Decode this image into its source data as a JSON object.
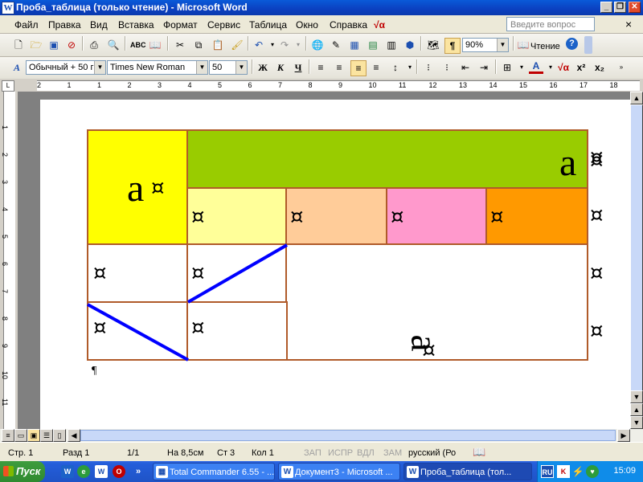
{
  "window": {
    "title": "Проба_таблица (только чтение) - Microsoft Word",
    "app_icon": "W"
  },
  "menu": {
    "items": [
      "Файл",
      "Правка",
      "Вид",
      "Вставка",
      "Формат",
      "Сервис",
      "Таблица",
      "Окно",
      "Справка"
    ],
    "ask_placeholder": "Введите вопрос"
  },
  "toolbar_standard": {
    "zoom": "90%",
    "reading_label": "Чтение"
  },
  "toolbar_format": {
    "style": "Обычный + 50 г",
    "font": "Times New Roman",
    "size": "50",
    "bold": "Ж",
    "italic": "К",
    "underline": "Ч"
  },
  "ruler": {
    "h_marks": [
      "2",
      "1",
      "1",
      "2",
      "3",
      "4",
      "5",
      "6",
      "7",
      "8",
      "9",
      "10",
      "11",
      "12",
      "13",
      "14",
      "15",
      "16",
      "17",
      "18"
    ],
    "v_marks": [
      "1",
      "2",
      "3",
      "4",
      "5",
      "6",
      "7",
      "8",
      "9",
      "10",
      "11"
    ]
  },
  "document": {
    "cell_mark": "¤",
    "big_letter": "a",
    "paragraph_mark": "¶",
    "colors": {
      "yellow": "#ffff00",
      "green": "#99cc00",
      "light_yellow": "#ffff99",
      "peach": "#ffcc99",
      "pink": "#ff99cc",
      "orange": "#ff9900",
      "border": "#b05b2a",
      "diagonal": "#0000ff"
    }
  },
  "status": {
    "page": "Стр. 1",
    "section": "Разд 1",
    "pages": "1/1",
    "at": "На 8,5см",
    "line": "Ст 3",
    "col": "Кол 1",
    "rec": "ЗАП",
    "trk": "ИСПР",
    "ext": "ВДЛ",
    "ovr": "ЗАМ",
    "lang": "русский (Ро"
  },
  "taskbar": {
    "start": "Пуск",
    "tasks": [
      "Total Commander 6.55 - ...",
      "Документ3 - Microsoft ...",
      "Проба_таблица (тол..."
    ],
    "tray_lang": "RU",
    "clock": "15:09"
  }
}
